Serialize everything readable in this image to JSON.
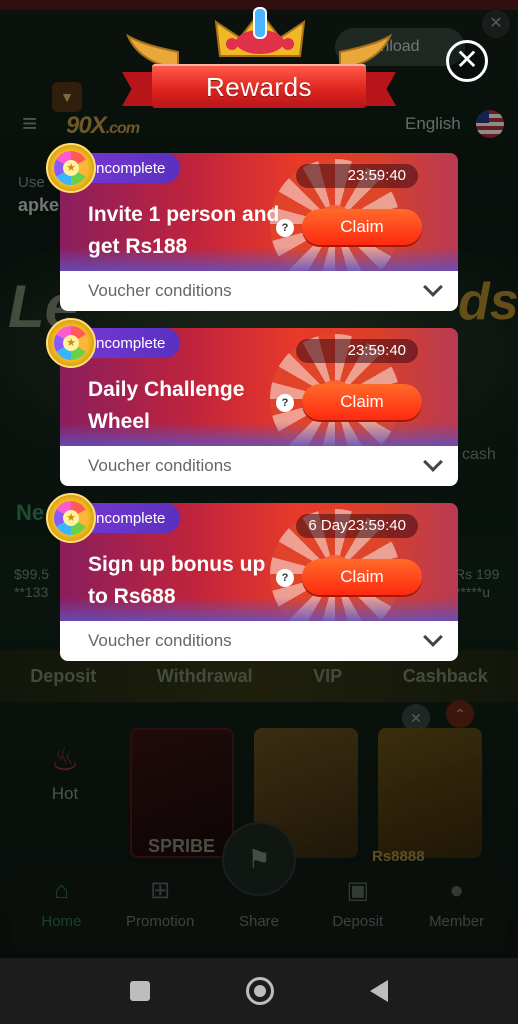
{
  "background": {
    "download_label": "nload",
    "logo_text": "90X",
    "logo_suffix": ".com",
    "language": "English",
    "user_label": "Use",
    "user_name": "apke",
    "banner_left": "Le",
    "banner_right": "ds",
    "cash_label": "cash",
    "section_label": "Ne",
    "amount_left_top": "$99.5",
    "amount_left_bottom": "**133",
    "amount_right_top": "Rs 199",
    "amount_right_bottom": "*****u",
    "quick_links": [
      "Deposit",
      "Withdrawal",
      "VIP",
      "Cashback"
    ],
    "hot_label": "Hot",
    "tile_label_1": "SPRIBE",
    "tile_label_2": "Rs8888",
    "nav": [
      {
        "label": "Home",
        "icon": "home-icon"
      },
      {
        "label": "Promotion",
        "icon": "gift-icon"
      },
      {
        "label": "Share",
        "icon": "share-icon"
      },
      {
        "label": "Deposit",
        "icon": "wallet-icon"
      },
      {
        "label": "Member",
        "icon": "member-icon"
      }
    ]
  },
  "modal": {
    "title": "Rewards",
    "close_symbol": "✕",
    "cards": [
      {
        "status": "Incomplete",
        "timer": "23:59:40",
        "title": "Invite 1 person and get Rs188",
        "claim": "Claim",
        "conditions": "Voucher conditions"
      },
      {
        "status": "Incomplete",
        "timer": "23:59:40",
        "title": "Daily Challenge Wheel",
        "claim": "Claim",
        "conditions": "Voucher conditions"
      },
      {
        "status": "Incomplete",
        "timer": "6 Day23:59:40",
        "title": "Sign up bonus up to Rs688",
        "claim": "Claim",
        "conditions": "Voucher conditions"
      }
    ]
  },
  "colors": {
    "ribbon": "#e0241e",
    "claim": "#ff2a10",
    "status_pill": "#7a3ad6"
  }
}
